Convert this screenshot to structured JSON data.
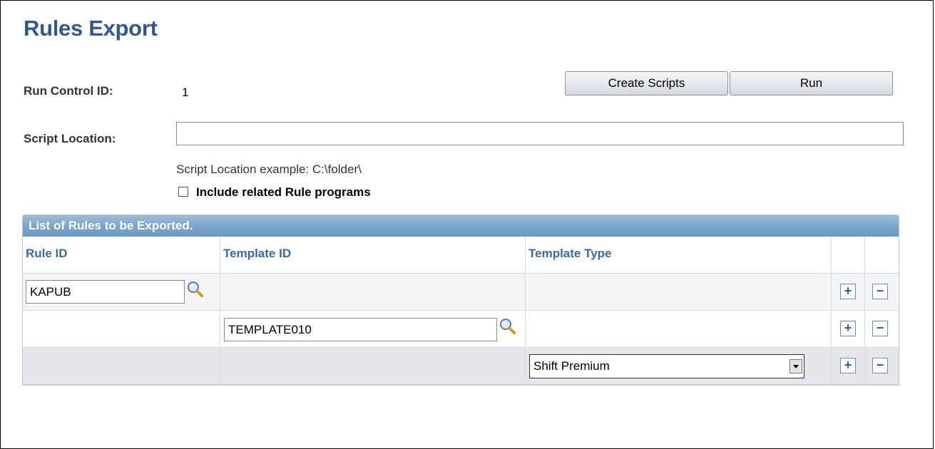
{
  "page": {
    "title": "Rules Export"
  },
  "run_control": {
    "label": "Run Control ID:",
    "value": "1"
  },
  "buttons": {
    "create_scripts": "Create Scripts",
    "run": "Run"
  },
  "script_location": {
    "label": "Script Location:",
    "value": "",
    "hint": "Script Location example: C:\\folder\\"
  },
  "include_related": {
    "label": "Include related Rule programs",
    "checked": false
  },
  "grid": {
    "title": "List of Rules to be Exported.",
    "columns": [
      "Rule ID",
      "Template ID",
      "Template Type"
    ],
    "rows": [
      {
        "rule_id": "KAPUB",
        "template_id": "",
        "template_type": ""
      },
      {
        "rule_id": "",
        "template_id": "TEMPLATE010",
        "template_type": ""
      },
      {
        "rule_id": "",
        "template_id": "",
        "template_type": "Shift Premium"
      }
    ],
    "add_symbol": "+",
    "remove_symbol": "−"
  },
  "icons": {
    "lookup": "magnifier-icon",
    "add_row": "plus-icon",
    "delete_row": "minus-icon",
    "dropdown": "chevron-down-icon"
  },
  "colors": {
    "title": "#34578c",
    "grid_header": "#7ba5cb",
    "column_header_text": "#3e69a0"
  }
}
